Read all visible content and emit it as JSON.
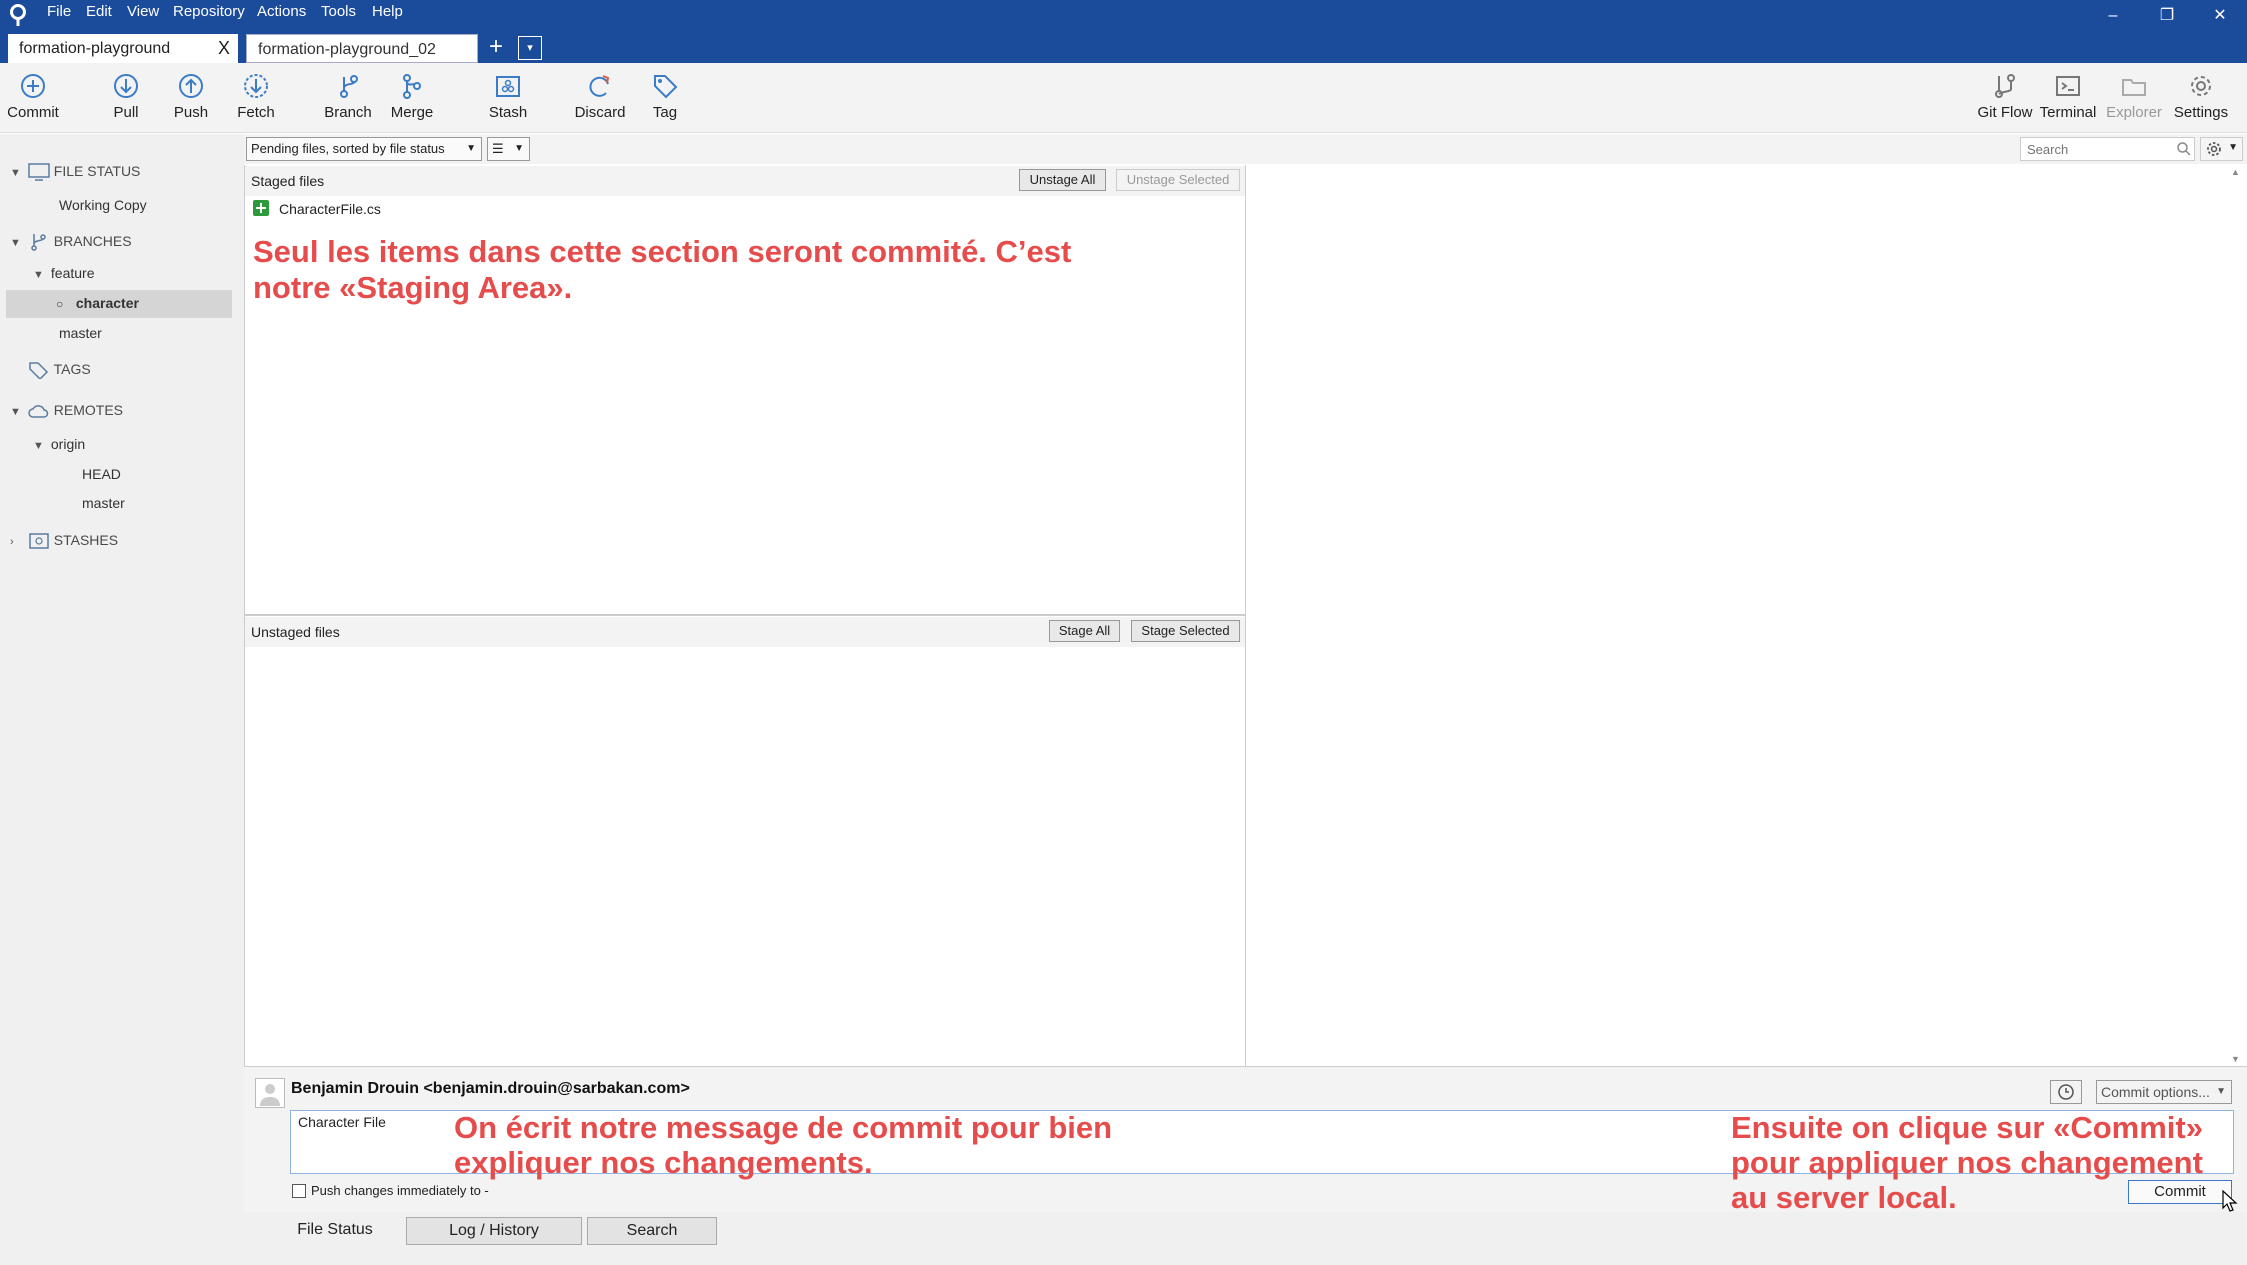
{
  "menu": [
    "File",
    "Edit",
    "View",
    "Repository",
    "Actions",
    "Tools",
    "Help"
  ],
  "window_controls": {
    "minimize": "–",
    "restore": "❐",
    "close": "✕"
  },
  "tabs": [
    {
      "label": "formation-playground",
      "close": "X"
    },
    {
      "label": "formation-playground_02"
    }
  ],
  "tab_add": "+",
  "tab_dropdown": "▾",
  "toolbar": {
    "commit": "Commit",
    "pull": "Pull",
    "push": "Push",
    "fetch": "Fetch",
    "branch": "Branch",
    "merge": "Merge",
    "stash": "Stash",
    "discard": "Discard",
    "tag": "Tag",
    "git_flow": "Git Flow",
    "terminal": "Terminal",
    "explorer": "Explorer",
    "settings": "Settings"
  },
  "sidebar": {
    "file_status": "FILE STATUS",
    "working_copy": "Working Copy",
    "branches": "BRANCHES",
    "feature": "feature",
    "character": "character",
    "master": "master",
    "tags": "TAGS",
    "remotes": "REMOTES",
    "origin": "origin",
    "head": "HEAD",
    "remote_master": "master",
    "stashes": "STASHES"
  },
  "filter": {
    "label": "Pending files, sorted by file status",
    "view": "☰",
    "search_placeholder": "Search"
  },
  "staged": {
    "title": "Staged files",
    "unstage_all": "Unstage All",
    "unstage_selected": "Unstage Selected",
    "files": [
      "CharacterFile.cs"
    ]
  },
  "unstaged": {
    "title": "Unstaged files",
    "stage_all": "Stage All",
    "stage_selected": "Stage Selected"
  },
  "annotations": {
    "staging_1": "Seul les items dans cette section seront commité. C’est",
    "staging_2": "notre «Staging Area».",
    "message_1": "On écrit notre message de commit pour bien",
    "message_2": "expliquer nos changements.",
    "commit_1": "Ensuite on clique sur «Commit»",
    "commit_2": "pour appliquer nos changement",
    "commit_3": "au server local."
  },
  "commit": {
    "author": "Benjamin Drouin <benjamin.drouin@sarbakan.com>",
    "message": "Character File",
    "push_label": "Push changes immediately to -",
    "options": "Commit options...",
    "button": "Commit"
  },
  "bottom_tabs": [
    "File Status",
    "Log / History",
    "Search"
  ],
  "colors": {
    "titlebar": "#1b4c9c",
    "annotation": "#e74c4c",
    "added": "#2e9b3a"
  }
}
